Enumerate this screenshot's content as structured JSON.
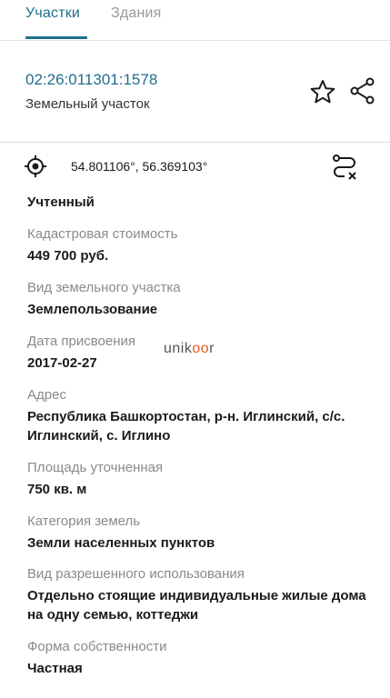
{
  "tabs": [
    {
      "label": "Участки",
      "active": true
    },
    {
      "label": "Здания",
      "active": false
    }
  ],
  "header": {
    "cadastral_number": "02:26:011301:1578",
    "object_type": "Земельный участок"
  },
  "coords": {
    "text": "54.801106°, 56.369103°"
  },
  "fields": [
    {
      "label": "",
      "value": "Учтенный"
    },
    {
      "label": "Кадастровая стоимость",
      "value": "449 700 руб."
    },
    {
      "label": "Вид земельного участка",
      "value": "Землепользование"
    },
    {
      "label": "Дата присвоения",
      "value": "2017-02-27"
    },
    {
      "label": "Адрес",
      "value": "Республика Башкортостан, р-н. Иглинский, с/с. Иглинский, с. Иглино"
    },
    {
      "label": "Площадь уточненная",
      "value": "750 кв. м"
    },
    {
      "label": "Категория земель",
      "value": "Земли населенных пунктов"
    },
    {
      "label": "Вид разрешенного использования",
      "value": "Отдельно стоящие индивидуальные жилые дома на одну семью, коттеджи"
    },
    {
      "label": "Форма собственности",
      "value": "Частная"
    }
  ],
  "watermark": {
    "prefix": "unik",
    "mid": "oo",
    "suffix": "r"
  },
  "colors": {
    "accent": "#1f6e8c",
    "label": "#8a8a8a",
    "watermark_accent": "#e85a1c"
  }
}
